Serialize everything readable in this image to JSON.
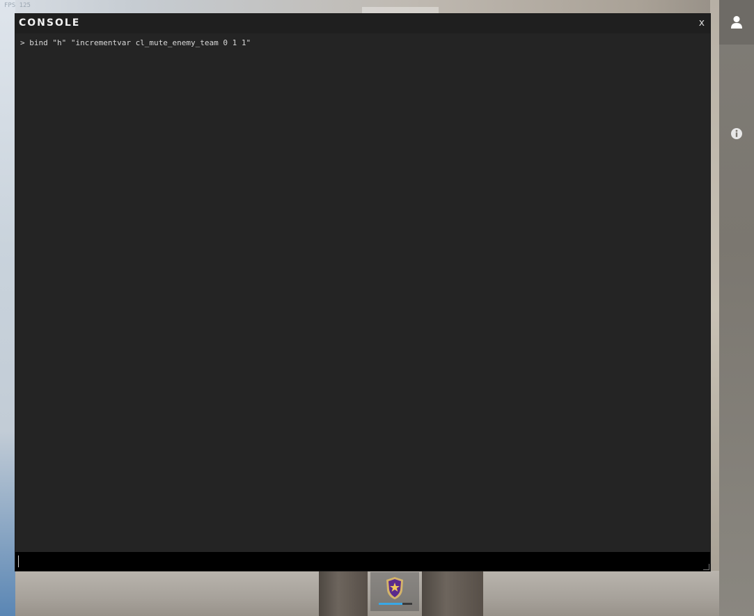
{
  "overlay": {
    "fps_text": "FPS 125"
  },
  "console": {
    "title": "CONSOLE",
    "close_label": "x",
    "lines": [
      "> bind \"h\" \"incrementvar cl_mute_enemy_team 0 1 1\""
    ],
    "input_value": ""
  },
  "sidebar": {
    "profile_icon": "user-icon",
    "info_icon": "info-icon"
  },
  "rank_badge": {
    "icon": "shield-star-icon",
    "progress": 0.7,
    "colors": {
      "shield": "#5b2a8c",
      "star": "#f0c75a",
      "bar": "#39a7e6"
    }
  }
}
